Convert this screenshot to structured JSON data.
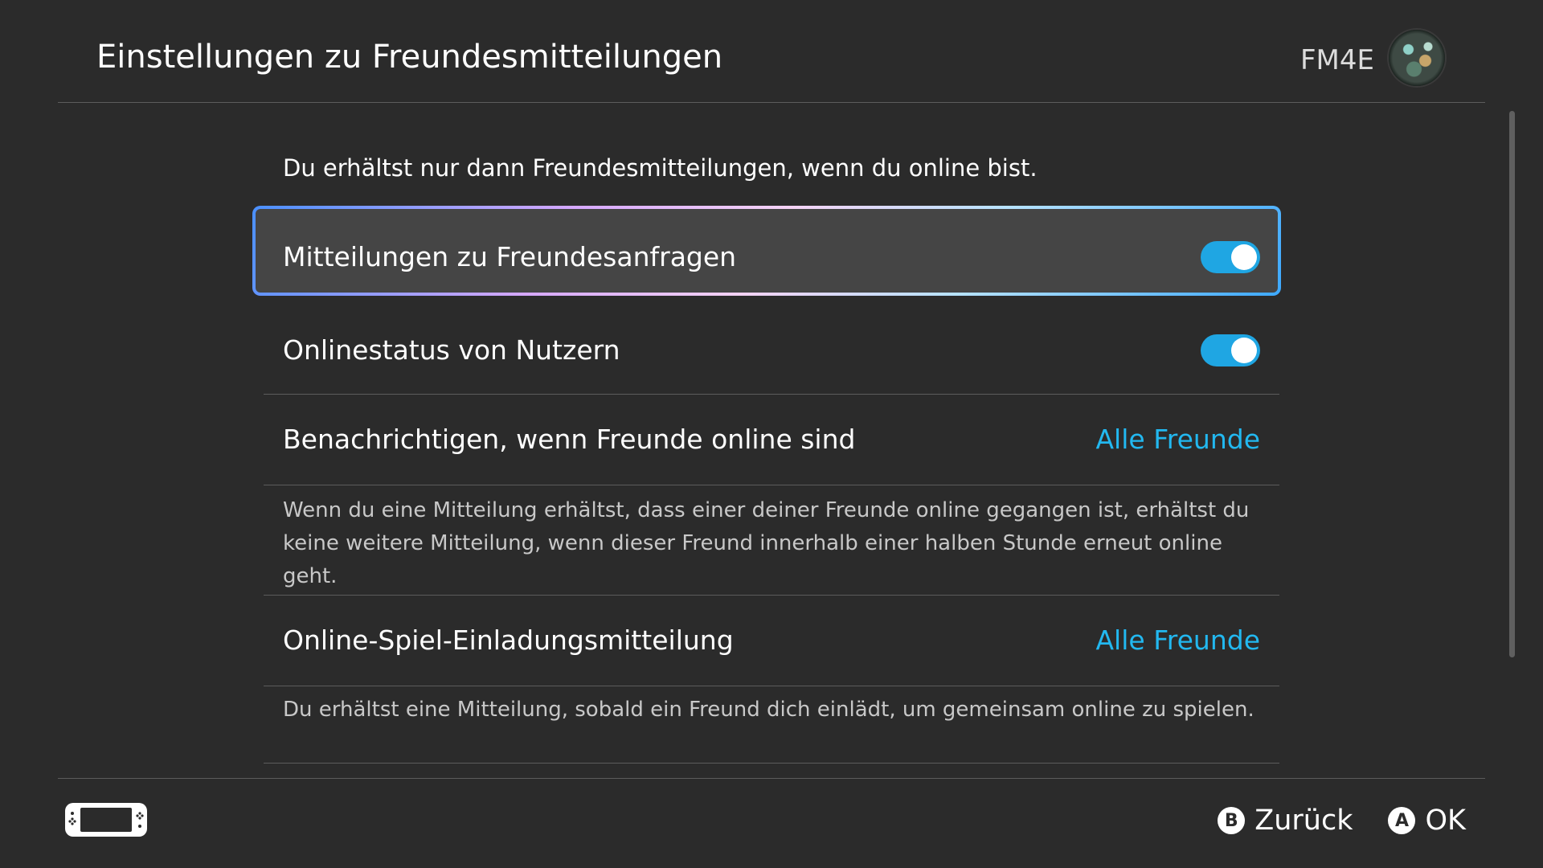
{
  "header": {
    "title": "Einstellungen zu Freundesmitteilungen",
    "user_name": "FM4E",
    "avatar_icon": "user-avatar"
  },
  "main": {
    "intro": "Du erhältst nur dann Freundesmitteilungen, wenn du online bist.",
    "settings": [
      {
        "label": "Mitteilungen zu Freundesanfragen",
        "type": "toggle",
        "state": "on",
        "selected": true
      },
      {
        "label": "Onlinestatus von Nutzern",
        "type": "toggle",
        "state": "on",
        "selected": false
      },
      {
        "label": "Benachrichtigen, wenn Freunde online sind",
        "type": "option",
        "value": "Alle Freunde",
        "description": "Wenn du eine Mitteilung erhältst, dass einer deiner Freunde online gegangen ist, erhältst du keine weitere Mitteilung, wenn dieser Freund innerhalb einer halben Stunde erneut online geht."
      },
      {
        "label": "Online-Spiel-Einladungsmitteilung",
        "type": "option",
        "value": "Alle Freunde",
        "description": "Du erhältst eine Mitteilung, sobald ein Freund dich einlädt, um gemeinsam online zu spielen."
      }
    ]
  },
  "footer": {
    "console_icon": "handheld-console-icon",
    "back": {
      "glyph": "B",
      "label": "Zurück"
    },
    "ok": {
      "glyph": "A",
      "label": "OK"
    }
  },
  "colors": {
    "background": "#2b2b2b",
    "accent": "#22b8f0",
    "toggle_on": "#1fa6e3",
    "selected_row": "#454545"
  }
}
